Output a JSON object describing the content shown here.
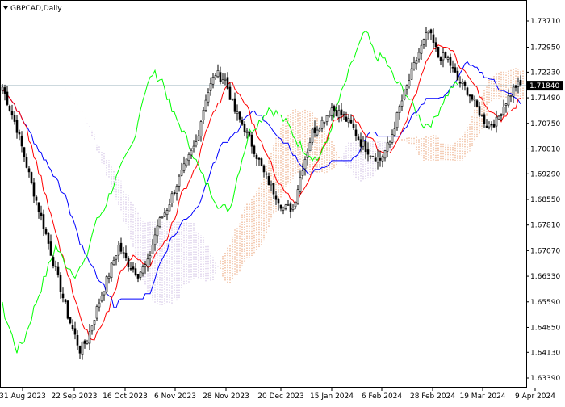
{
  "symbol_title": "GBPCAD,Daily",
  "last_price_label": "1.71840",
  "colors": {
    "background": "#ffffff",
    "frame": "#000000",
    "candle": "#000000",
    "tenkan": "#ff0000",
    "kijun": "#0000ff",
    "chikou": "#00ff00",
    "span_a_cloud": "#e07838",
    "span_b_cloud": "#b8a0d8",
    "price_line": "#7a9aa8"
  },
  "chart_data": {
    "type": "candlestick",
    "title": "GBPCAD,Daily",
    "indicator": "Ichimoku Kinko Hyo",
    "xlabel": "",
    "ylabel": "",
    "ylim": [
      1.6339,
      1.7399
    ],
    "y_ticks": [
      "1.73710",
      "1.72950",
      "1.72230",
      "1.71490",
      "1.70750",
      "1.70010",
      "1.69290",
      "1.68550",
      "1.67810",
      "1.67070",
      "1.66330",
      "1.65590",
      "1.64850",
      "1.64130",
      "1.63390"
    ],
    "x_tick_labels": [
      "31 Aug 2023",
      "22 Sep 2023",
      "16 Oct 2023",
      "6 Nov 2023",
      "28 Nov 2023",
      "20 Dec 2023",
      "15 Jan 2024",
      "6 Feb 2024",
      "28 Feb 2024",
      "19 Mar 2024",
      "9 Apr 2024"
    ],
    "last_price": 1.7184,
    "grid": false,
    "close_anchors": [
      [
        0,
        1.718
      ],
      [
        6,
        1.706
      ],
      [
        12,
        1.69
      ],
      [
        17,
        1.678
      ],
      [
        22,
        1.665
      ],
      [
        27,
        1.652
      ],
      [
        32,
        1.642
      ],
      [
        35,
        1.645
      ],
      [
        40,
        1.656
      ],
      [
        44,
        1.664
      ],
      [
        48,
        1.672
      ],
      [
        52,
        1.667
      ],
      [
        56,
        1.664
      ],
      [
        60,
        1.667
      ],
      [
        64,
        1.678
      ],
      [
        68,
        1.683
      ],
      [
        72,
        1.69
      ],
      [
        76,
        1.696
      ],
      [
        80,
        1.702
      ],
      [
        84,
        1.715
      ],
      [
        88,
        1.722
      ],
      [
        92,
        1.72
      ],
      [
        96,
        1.711
      ],
      [
        100,
        1.706
      ],
      [
        104,
        1.7
      ],
      [
        108,
        1.693
      ],
      [
        112,
        1.688
      ],
      [
        116,
        1.683
      ],
      [
        120,
        1.683
      ],
      [
        124,
        1.695
      ],
      [
        128,
        1.705
      ],
      [
        132,
        1.708
      ],
      [
        136,
        1.712
      ],
      [
        140,
        1.71
      ],
      [
        144,
        1.707
      ],
      [
        148,
        1.702
      ],
      [
        152,
        1.699
      ],
      [
        156,
        1.697
      ],
      [
        160,
        1.702
      ],
      [
        164,
        1.712
      ],
      [
        168,
        1.72
      ],
      [
        172,
        1.728
      ],
      [
        176,
        1.734
      ],
      [
        180,
        1.727
      ],
      [
        184,
        1.726
      ],
      [
        188,
        1.72
      ],
      [
        192,
        1.717
      ],
      [
        196,
        1.712
      ],
      [
        200,
        1.707
      ],
      [
        204,
        1.708
      ],
      [
        208,
        1.714
      ],
      [
        212,
        1.7184
      ]
    ]
  }
}
